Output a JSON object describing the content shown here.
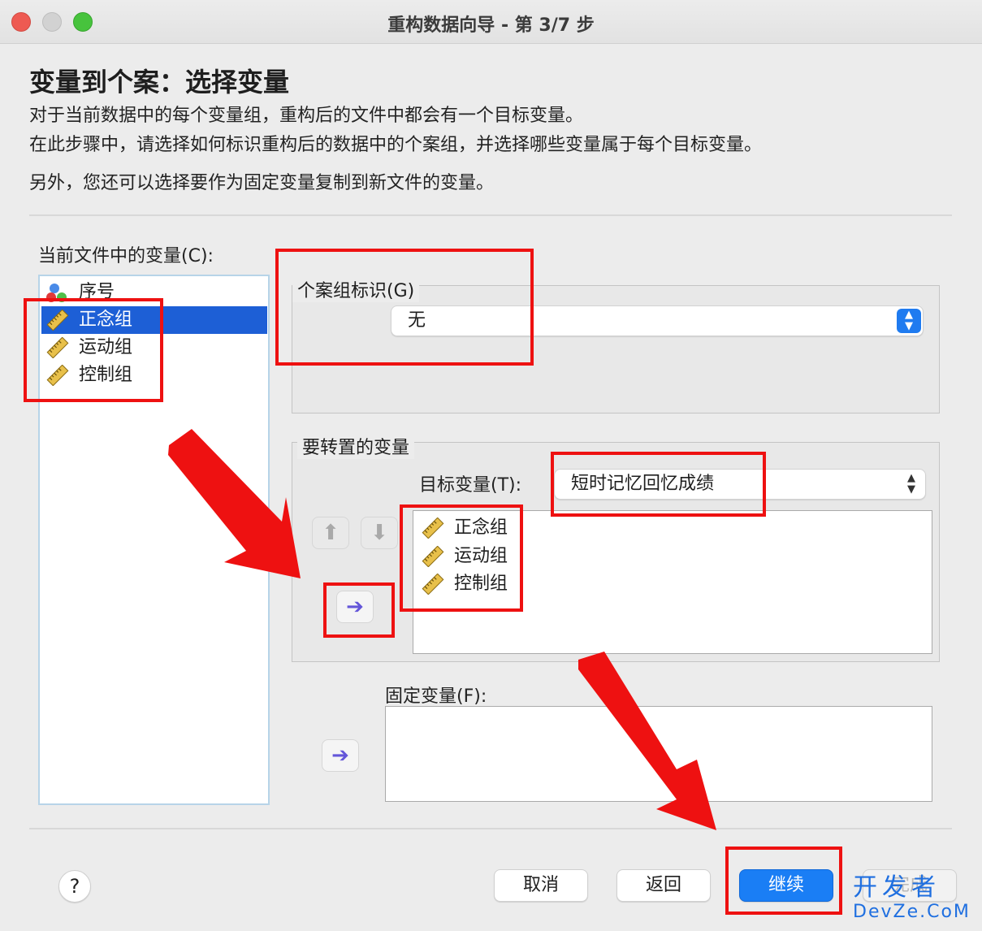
{
  "window": {
    "title": "重构数据向导 - 第 3/7 步"
  },
  "header": {
    "heading": "变量到个案：选择变量",
    "line1": "对于当前数据中的每个变量组，重构后的文件中都会有一个目标变量。",
    "line2": "在此步骤中，请选择如何标识重构后的数据中的个案组，并选择哪些变量属于每个目标变量。",
    "line3": "另外，您还可以选择要作为固定变量复制到新文件的变量。"
  },
  "source": {
    "label": "当前文件中的变量(C):",
    "items": [
      {
        "label": "序号",
        "icon": "nominal-variable-icon"
      },
      {
        "label": "正念组",
        "icon": "ruler-icon",
        "selected": true
      },
      {
        "label": "运动组",
        "icon": "ruler-icon"
      },
      {
        "label": "控制组",
        "icon": "ruler-icon"
      }
    ]
  },
  "case_group": {
    "legend": "个案组标识(G)",
    "value": "无"
  },
  "transpose": {
    "legend": "要转置的变量",
    "target_label": "目标变量(T):",
    "target_value": "短时记忆回忆成绩",
    "items": [
      "正念组",
      "运动组",
      "控制组"
    ]
  },
  "fixed": {
    "label": "固定变量(F):"
  },
  "buttons": {
    "cancel": "取消",
    "back": "返回",
    "continue": "继续",
    "finish": "完成",
    "help": "?"
  },
  "watermark": {
    "line1": "开发者",
    "line2": "DevZe.CoM"
  },
  "colors": {
    "accent": "#1a7ef5",
    "annotation_red": "#ee1111",
    "selection": "#1d5fd6"
  }
}
